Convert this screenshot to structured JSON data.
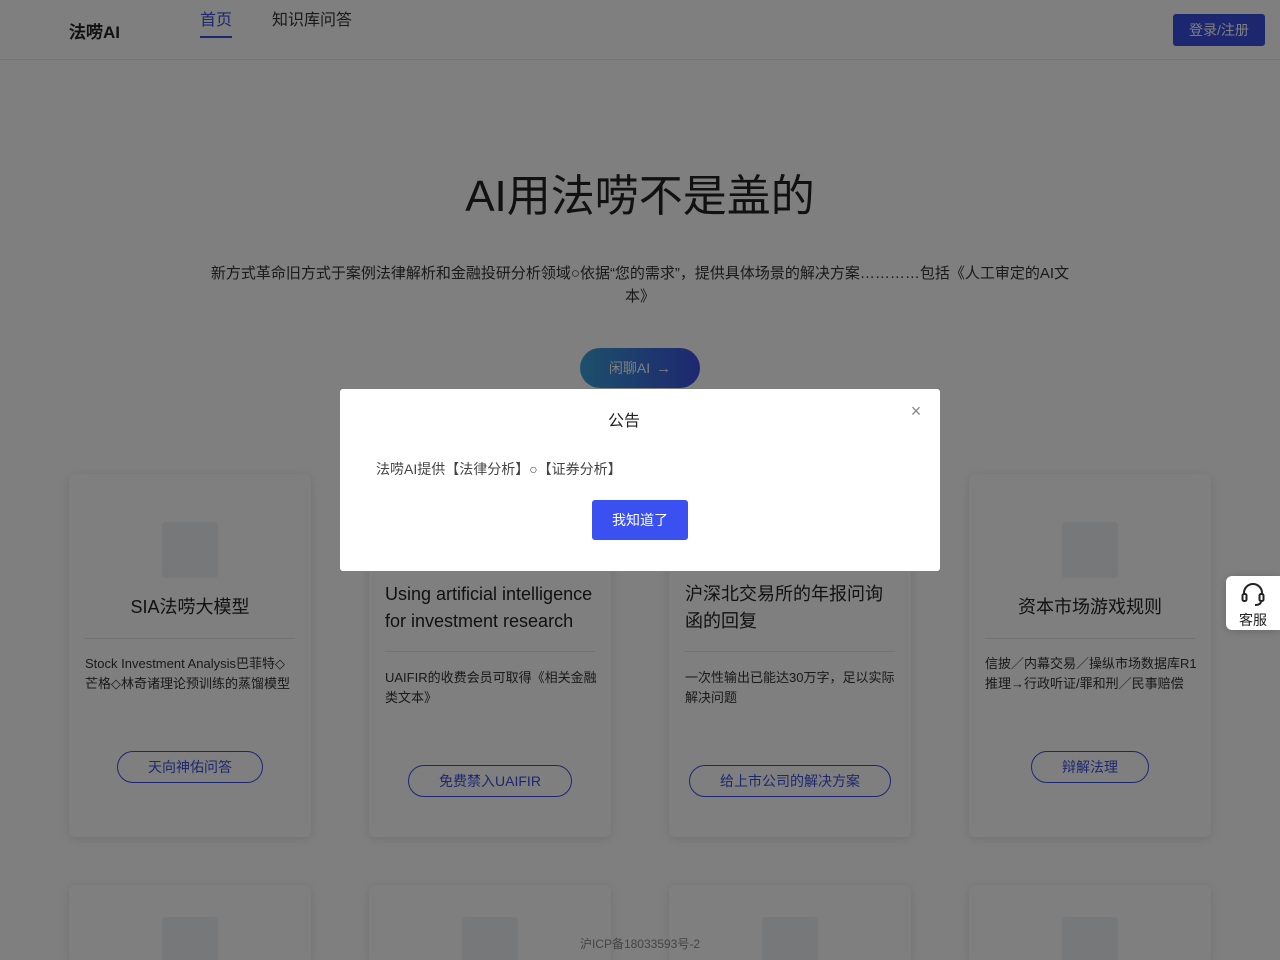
{
  "header": {
    "logo": "法唠AI",
    "tabs": [
      {
        "label": "首页",
        "active": true
      },
      {
        "label": "知识库问答",
        "active": false
      }
    ],
    "login_label": "登录/注册"
  },
  "hero": {
    "title": "AI用法唠不是盖的",
    "description": "新方式革命旧方式于案例法律解析和金融投研分析领域○依据“您的需求”，提供具体场景的解决方案…………包括《人工审定的AI文本》",
    "chat_button": "闲聊AI",
    "chat_arrow": "→"
  },
  "cards": [
    {
      "title": "SIA法唠大模型",
      "desc": "Stock Investment Analysis巴菲特◇芒格◇林奇诸理论预训练的蒸馏模型",
      "button": "天向神佑问答"
    },
    {
      "title": "Using artificial intelligence for investment research",
      "desc": "UAIFIR的收费会员可取得《相关金融类文本》",
      "button": "免费禁入UAIFIR"
    },
    {
      "title": "沪深北交易所的年报问询函的回复",
      "desc": "一次性输出已能达30万字，足以实际解决问题",
      "button": "给上市公司的解决方案"
    },
    {
      "title": "资本市场游戏规则",
      "desc": "信披／内幕交易／操纵市场数据库R1推理→行政听证/罪和刑／民事赔偿",
      "button": "辩解法理"
    }
  ],
  "footer": {
    "icp": "沪ICP备18033593号-2"
  },
  "service": {
    "label": "客服"
  },
  "modal": {
    "title": "公告",
    "close": "×",
    "body": "法唠AI提供【法律分析】○【证券分析】",
    "confirm": "我知道了"
  },
  "colors": {
    "accent": "#3b4fe0",
    "overlay": "rgba(0,0,0,0.5)"
  }
}
